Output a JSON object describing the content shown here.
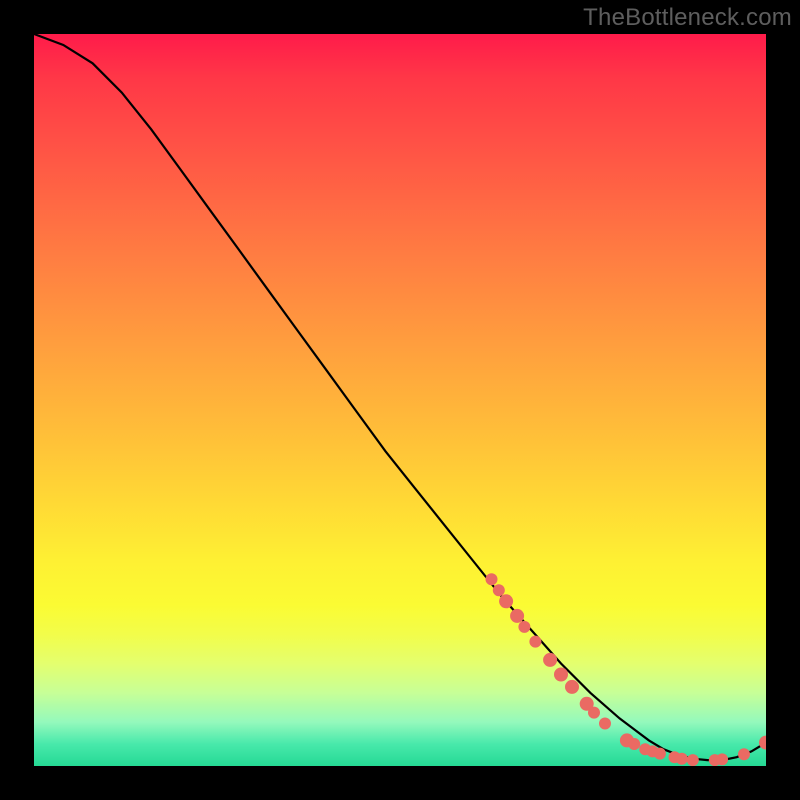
{
  "watermark": "TheBottleneck.com",
  "chart_data": {
    "type": "line",
    "title": "",
    "xlabel": "",
    "ylabel": "",
    "xlim": [
      0,
      100
    ],
    "ylim": [
      0,
      100
    ],
    "grid": false,
    "series": [
      {
        "name": "bottleneck-curve",
        "x": [
          0,
          4,
          8,
          12,
          16,
          20,
          24,
          28,
          32,
          36,
          40,
          44,
          48,
          52,
          56,
          60,
          64,
          68,
          72,
          76,
          80,
          82,
          84,
          86,
          88,
          90,
          92,
          94,
          96,
          98,
          100
        ],
        "y": [
          100,
          98.5,
          96,
          92,
          87,
          81.5,
          76,
          70.5,
          65,
          59.5,
          54,
          48.5,
          43,
          38,
          33,
          28,
          23,
          18.5,
          14,
          10,
          6.5,
          5,
          3.5,
          2.3,
          1.5,
          1,
          0.8,
          0.8,
          1.2,
          2,
          3.2
        ]
      }
    ],
    "markers": {
      "name": "highlight-points",
      "color": "#ea6a63",
      "points": [
        {
          "x": 62.5,
          "y": 25.5,
          "r": 6
        },
        {
          "x": 63.5,
          "y": 24.0,
          "r": 6
        },
        {
          "x": 64.5,
          "y": 22.5,
          "r": 7
        },
        {
          "x": 66.0,
          "y": 20.5,
          "r": 7
        },
        {
          "x": 67.0,
          "y": 19.0,
          "r": 6
        },
        {
          "x": 68.5,
          "y": 17.0,
          "r": 6
        },
        {
          "x": 70.5,
          "y": 14.5,
          "r": 7
        },
        {
          "x": 72.0,
          "y": 12.5,
          "r": 7
        },
        {
          "x": 73.5,
          "y": 10.8,
          "r": 7
        },
        {
          "x": 75.5,
          "y": 8.5,
          "r": 7
        },
        {
          "x": 76.5,
          "y": 7.3,
          "r": 6
        },
        {
          "x": 78.0,
          "y": 5.8,
          "r": 6
        },
        {
          "x": 81.0,
          "y": 3.5,
          "r": 7
        },
        {
          "x": 82.0,
          "y": 3.0,
          "r": 6
        },
        {
          "x": 83.5,
          "y": 2.3,
          "r": 6
        },
        {
          "x": 84.5,
          "y": 2.0,
          "r": 6
        },
        {
          "x": 85.5,
          "y": 1.7,
          "r": 6
        },
        {
          "x": 87.5,
          "y": 1.2,
          "r": 6
        },
        {
          "x": 88.5,
          "y": 1.0,
          "r": 6
        },
        {
          "x": 90.0,
          "y": 0.8,
          "r": 6
        },
        {
          "x": 93.0,
          "y": 0.8,
          "r": 6
        },
        {
          "x": 94.0,
          "y": 0.9,
          "r": 6
        },
        {
          "x": 97.0,
          "y": 1.6,
          "r": 6
        },
        {
          "x": 100.0,
          "y": 3.2,
          "r": 7
        }
      ]
    },
    "background_gradient": {
      "orientation": "vertical",
      "stops": [
        {
          "pos": 0.0,
          "color": "#ff1b4a"
        },
        {
          "pos": 0.5,
          "color": "#ffbd39"
        },
        {
          "pos": 0.78,
          "color": "#fbfb33"
        },
        {
          "pos": 1.0,
          "color": "#25d994"
        }
      ]
    }
  }
}
